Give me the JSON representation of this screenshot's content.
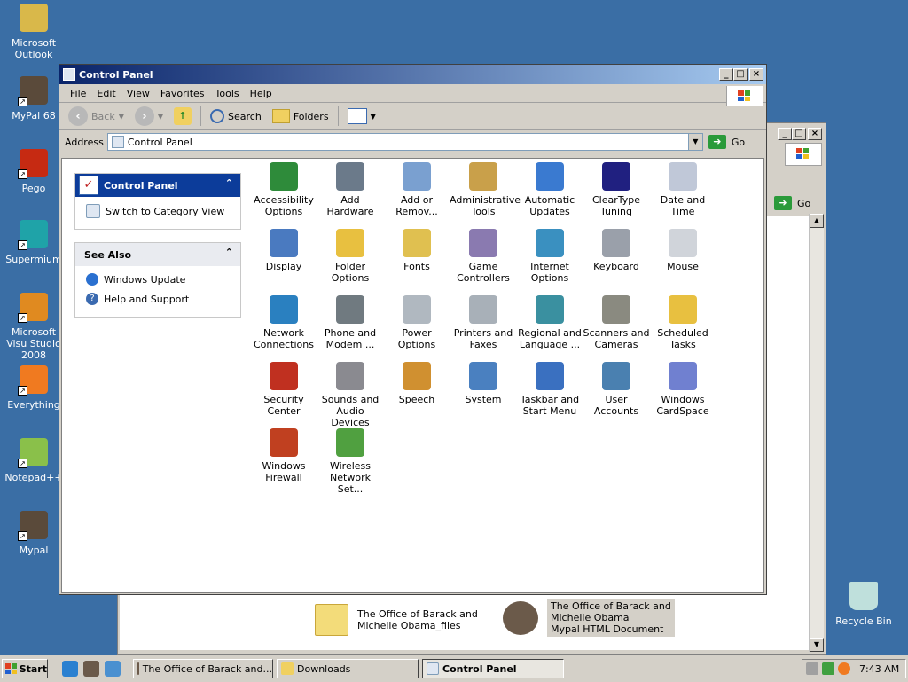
{
  "desktop": {
    "icons": [
      {
        "label": "Microsoft Outlook",
        "name": "outlook-icon",
        "color": "#d9b84a"
      },
      {
        "label": "MyPal 68",
        "name": "mypal-icon",
        "color": "#5a4a3a"
      },
      {
        "label": "Pego",
        "name": "pego-icon",
        "color": "#c62a12"
      },
      {
        "label": "Supermium",
        "name": "supermium-icon",
        "color": "#1fa3a8"
      },
      {
        "label": "Microsoft Visu Studio 2008",
        "name": "visual-studio-icon",
        "color": "#e08a20"
      },
      {
        "label": "Everything",
        "name": "everything-icon",
        "color": "#f07a20"
      },
      {
        "label": "Notepad++",
        "name": "notepadpp-icon",
        "color": "#8ac04a"
      },
      {
        "label": "Mypal",
        "name": "mypal2-icon",
        "color": "#5a4a3a"
      }
    ],
    "recycle_bin": "Recycle Bin"
  },
  "background_window": {
    "go_label": "Go",
    "files": [
      {
        "line1": "The Office of Barack and",
        "line2": "Michelle Obama_files",
        "line3": ""
      },
      {
        "line1": "The Office of Barack and",
        "line2": "Michelle Obama",
        "line3": "Mypal HTML Document"
      }
    ]
  },
  "window": {
    "title": "Control Panel",
    "menu": [
      "File",
      "Edit",
      "View",
      "Favorites",
      "Tools",
      "Help"
    ],
    "toolbar": {
      "back": "Back",
      "search": "Search",
      "folders": "Folders"
    },
    "address_label": "Address",
    "address_value": "Control Panel",
    "go_label": "Go",
    "left_panel": {
      "title": "Control Panel",
      "switch_link": "Switch to Category View",
      "see_also_title": "See Also",
      "see_also": [
        "Windows Update",
        "Help and Support"
      ]
    },
    "items": [
      {
        "l1": "Accessibility",
        "l2": "Options",
        "color": "#2e8b3a"
      },
      {
        "l1": "Add Hardware",
        "l2": "",
        "color": "#6b7a8a"
      },
      {
        "l1": "Add or",
        "l2": "Remov...",
        "color": "#7aa0d0"
      },
      {
        "l1": "Administrative",
        "l2": "Tools",
        "color": "#c9a04a"
      },
      {
        "l1": "Automatic",
        "l2": "Updates",
        "color": "#3a7ad0"
      },
      {
        "l1": "ClearType",
        "l2": "Tuning",
        "color": "#202080"
      },
      {
        "l1": "Date and Time",
        "l2": "",
        "color": "#c0c8d8"
      },
      {
        "l1": "Display",
        "l2": "",
        "color": "#4a7ac0"
      },
      {
        "l1": "Folder Options",
        "l2": "",
        "color": "#e8c040"
      },
      {
        "l1": "Fonts",
        "l2": "",
        "color": "#e0c050"
      },
      {
        "l1": "Game",
        "l2": "Controllers",
        "color": "#8a7ab0"
      },
      {
        "l1": "Internet",
        "l2": "Options",
        "color": "#3a90c0"
      },
      {
        "l1": "Keyboard",
        "l2": "",
        "color": "#9aa0aa"
      },
      {
        "l1": "Mouse",
        "l2": "",
        "color": "#d0d4da"
      },
      {
        "l1": "Network",
        "l2": "Connections",
        "color": "#2a80c0"
      },
      {
        "l1": "Phone and",
        "l2": "Modem ...",
        "color": "#707a80"
      },
      {
        "l1": "Power Options",
        "l2": "",
        "color": "#b0b8c0"
      },
      {
        "l1": "Printers and",
        "l2": "Faxes",
        "color": "#a8b0b8"
      },
      {
        "l1": "Regional and",
        "l2": "Language ...",
        "color": "#3a90a0"
      },
      {
        "l1": "Scanners and",
        "l2": "Cameras",
        "color": "#8a8a80"
      },
      {
        "l1": "Scheduled",
        "l2": "Tasks",
        "color": "#e8c040"
      },
      {
        "l1": "Security",
        "l2": "Center",
        "color": "#c03020"
      },
      {
        "l1": "Sounds and",
        "l2": "Audio Devices",
        "color": "#8a8a90"
      },
      {
        "l1": "Speech",
        "l2": "",
        "color": "#d09030"
      },
      {
        "l1": "System",
        "l2": "",
        "color": "#4a80c0"
      },
      {
        "l1": "Taskbar and",
        "l2": "Start Menu",
        "color": "#3a70c0"
      },
      {
        "l1": "User Accounts",
        "l2": "",
        "color": "#4a80b0"
      },
      {
        "l1": "Windows",
        "l2": "CardSpace",
        "color": "#7080d0"
      },
      {
        "l1": "Windows",
        "l2": "Firewall",
        "color": "#c04020"
      },
      {
        "l1": "Wireless",
        "l2": "Network Set...",
        "color": "#50a040"
      }
    ]
  },
  "taskbar": {
    "start": "Start",
    "tasks": [
      "The Office of Barack and...",
      "Downloads",
      "Control Panel"
    ],
    "clock": "7:43 AM"
  }
}
